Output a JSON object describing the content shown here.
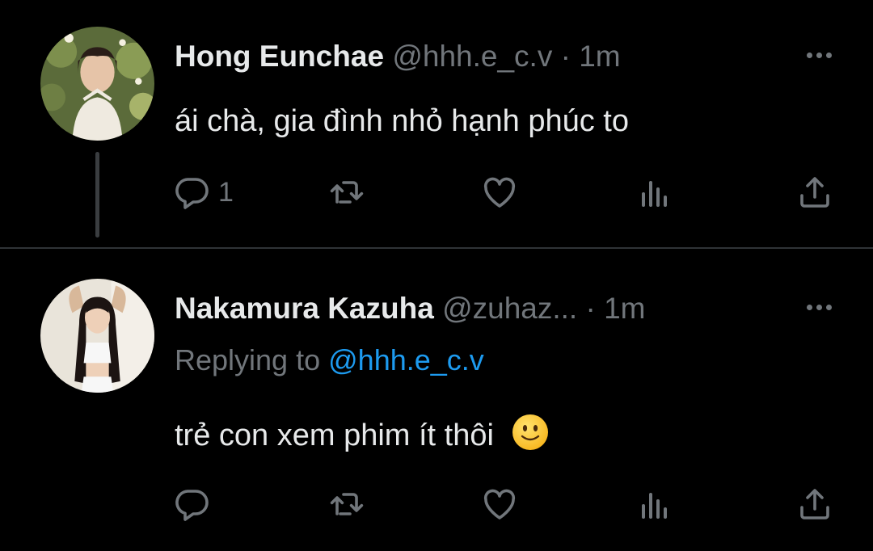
{
  "colors": {
    "background": "#000000",
    "primary_text": "#e7e9ea",
    "secondary_text": "#71767b",
    "link": "#1d9bf0",
    "divider": "#2f3336"
  },
  "tweets": [
    {
      "display_name": "Hong Eunchae",
      "handle": "@hhh.e_c.v",
      "separator": "·",
      "time": "1m",
      "text": "ái chà, gia đình nhỏ hạnh phúc to",
      "reply_count": "1",
      "icons": [
        "more-icon",
        "reply-icon",
        "retweet-icon",
        "like-icon",
        "views-icon",
        "share-icon"
      ]
    },
    {
      "display_name": "Nakamura Kazuha",
      "handle": "@zuhaz...",
      "separator": "·",
      "time": "1m",
      "replying_prefix": "Replying to",
      "replying_to": "@hhh.e_c.v",
      "text": "trẻ con xem phim ít thôi",
      "emoji": "slightly-smiling-face-emoji",
      "icons": [
        "more-icon",
        "reply-icon",
        "retweet-icon",
        "like-icon",
        "views-icon",
        "share-icon"
      ]
    }
  ]
}
